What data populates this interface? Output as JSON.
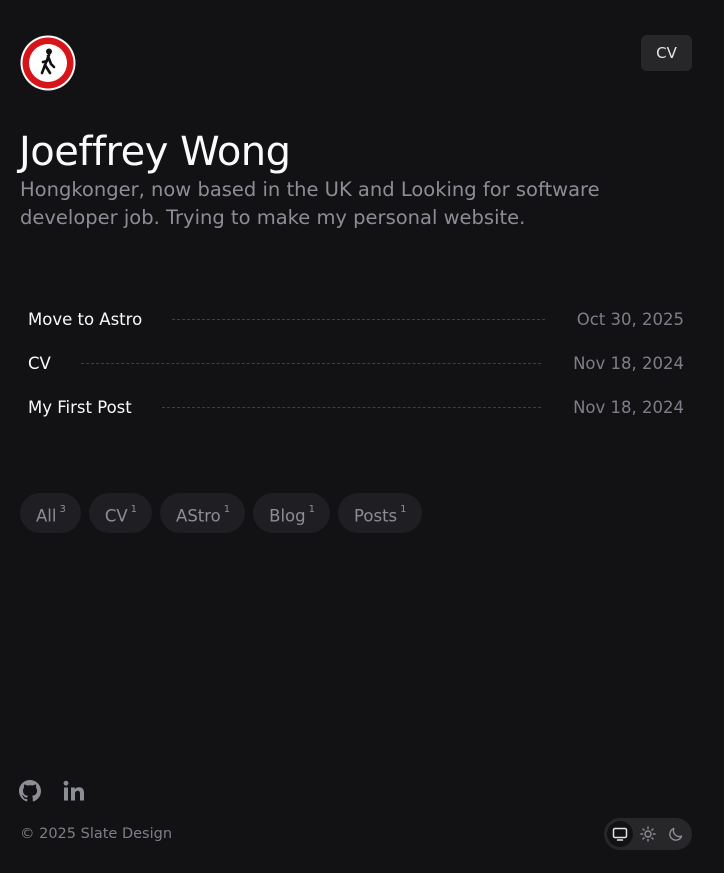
{
  "header": {
    "logo_icon": "no-pedestrians-sign-icon",
    "cv_label": "CV"
  },
  "hero": {
    "name": "Joeffrey Wong",
    "bio": "Hongkonger, now based in the UK and Looking for software developer job. Trying to make my personal website."
  },
  "posts": [
    {
      "title": "Move to Astro",
      "date": "Oct 30, 2025"
    },
    {
      "title": "CV",
      "date": "Nov 18, 2024"
    },
    {
      "title": "My First Post",
      "date": "Nov 18, 2024"
    }
  ],
  "tags": [
    {
      "label": "All",
      "count": "3"
    },
    {
      "label": "CV",
      "count": "1"
    },
    {
      "label": "AStro",
      "count": "1"
    },
    {
      "label": "Blog",
      "count": "1"
    },
    {
      "label": "Posts",
      "count": "1"
    }
  ],
  "footer": {
    "social_icons": [
      "github-icon",
      "linkedin-icon"
    ],
    "copyright": "© 2025 Slate Design",
    "theme_options": [
      "system-icon",
      "sun-icon",
      "moon-icon"
    ],
    "active_theme": "system"
  },
  "colors": {
    "background": "#121215",
    "logo_red": "#d7141a",
    "muted_text": "#8d8d96",
    "chip_background": "#1f1f23"
  }
}
